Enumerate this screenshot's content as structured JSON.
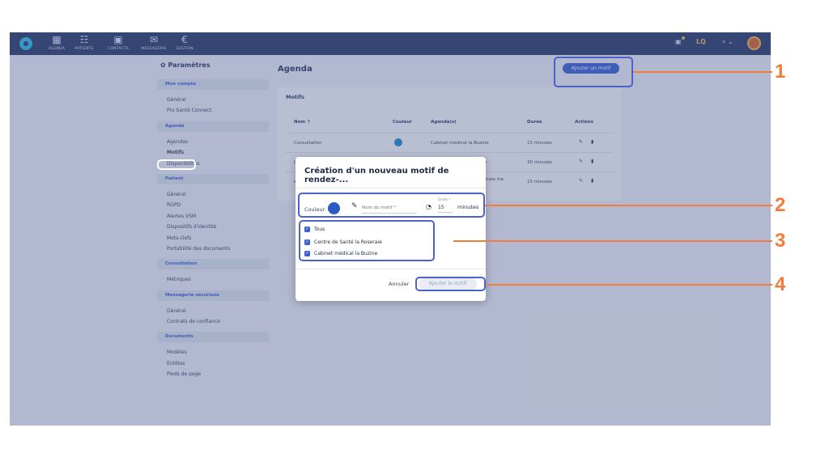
{
  "topbar": {
    "nav": [
      {
        "label": "AGENDA",
        "icon": "calendar-icon",
        "glyph": "▦"
      },
      {
        "label": "PATIENTS",
        "icon": "people-icon",
        "glyph": "☷"
      },
      {
        "label": "CONTACTS",
        "icon": "contacts-icon",
        "glyph": "▣"
      },
      {
        "label": "MESSAGERIE",
        "icon": "mail-icon",
        "glyph": "✉"
      },
      {
        "label": "GESTION",
        "icon": "euro-icon",
        "glyph": "€"
      }
    ],
    "right_text": "LQ",
    "search_caret": "⌕ ⌄"
  },
  "sidebar": {
    "title": "Paramètres",
    "sections": [
      {
        "label": "Mon compte",
        "items": [
          "Général",
          "Pro Santé Connect"
        ]
      },
      {
        "label": "Agenda",
        "items": [
          "Agendas",
          "Motifs",
          "Disponibilités"
        ]
      },
      {
        "label": "Patient",
        "items": [
          "Général",
          "RGPD",
          "Alertes VSM",
          "Dispositifs d'identité",
          "Mots-clefs",
          "Portabilité des documents"
        ]
      },
      {
        "label": "Consultation",
        "items": [
          "Métriques"
        ]
      },
      {
        "label": "Messagerie sécurisée",
        "items": [
          "Général",
          "Contrats de confiance"
        ]
      },
      {
        "label": "Documents",
        "items": [
          "Modèles",
          "Entêtes",
          "Pieds de page"
        ]
      }
    ],
    "active_item": "Motifs"
  },
  "main": {
    "title": "Agenda",
    "add_button": "Ajouter un motif",
    "card_title": "Motifs",
    "columns": [
      "Nom ↑",
      "Couleur",
      "Agenda(s)",
      "Durée",
      "Actions"
    ],
    "rows": [
      {
        "name": "Consultation",
        "agenda": "Cabinet médical la Buzine",
        "duration": "15 minutes"
      },
      {
        "name": "C",
        "agenda": "ine",
        "duration": "30 minutes"
      },
      {
        "name": "s",
        "agenda": "eraie ine",
        "duration": "15 minutes"
      }
    ],
    "action_edit": "✎",
    "action_delete": "▮"
  },
  "modal": {
    "title": "Création d'un nouveau motif de rendez-...",
    "color_label": "Couleur",
    "name_placeholder": "Nom du motif *",
    "duration_label": "Durée *",
    "duration_value": "15",
    "duration_unit": "minutes",
    "checkboxes": [
      "Tous",
      "Centre de Santé la Roseraie",
      "Cabinet médical la Buzine"
    ],
    "cancel": "Annuler",
    "submit": "Ajouter le motif"
  },
  "callouts": [
    "1",
    "2",
    "3",
    "4"
  ],
  "colors": {
    "accent": "#3b63d6",
    "topbar": "#2a3a66",
    "callout": "#f07d3c"
  }
}
